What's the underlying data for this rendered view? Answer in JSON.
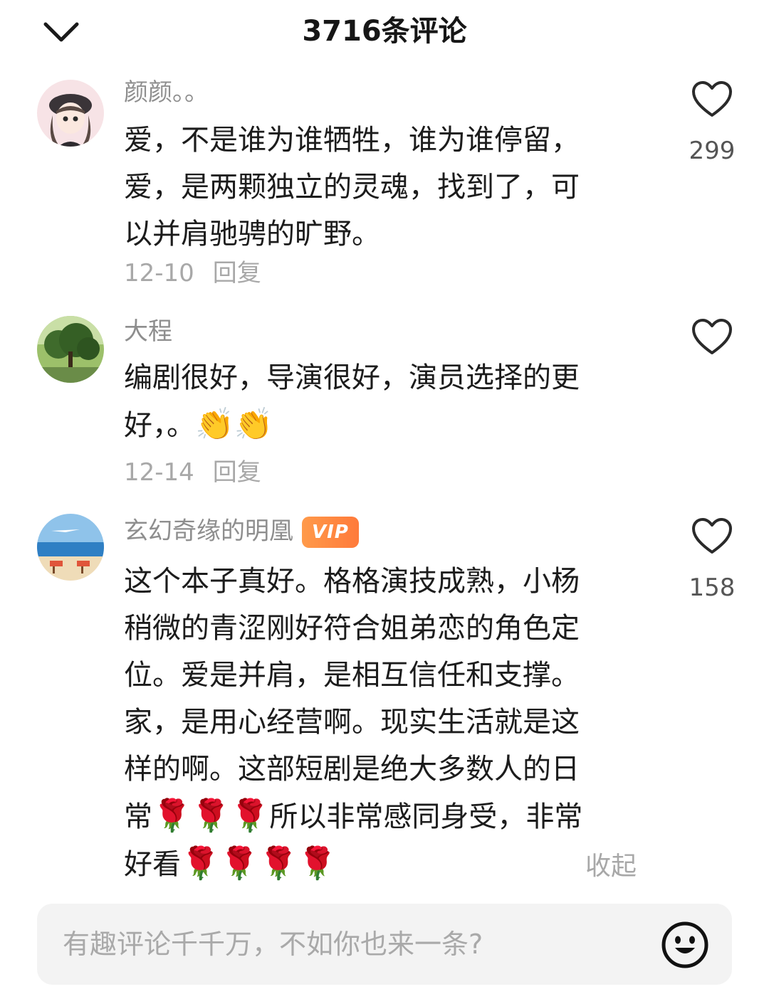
{
  "header": {
    "title": "3716条评论"
  },
  "comments": [
    {
      "username": "颜颜。。",
      "text": "爱，不是谁为谁牺牲，谁为谁停留，\n爱，是两颗独立的灵魂，找到了，可\n以并肩驰骋的旷野。",
      "date": "12-10",
      "reply_label": "回复",
      "likes": "299"
    },
    {
      "username": "大程",
      "text_main": "编剧很好，导演很好，演员选择的更\n好，。",
      "text_emoji": "👏👏",
      "date": "12-14",
      "reply_label": "回复",
      "likes": ""
    },
    {
      "username": "玄幻奇缘的明凰",
      "badge": "VIP",
      "text_part1": "这个本子真好。格格演技成熟，小杨\n稍微的青涩刚好符合姐弟恋的角色定\n位。爱是并肩，是相互信任和支撑。\n家，是用心经营啊。现实生活就是这\n样的啊。这部短剧是绝大多数人的日\n常",
      "emoji_a": "🌹🌹🌹",
      "text_part2": "所以非常感同身受，非常\n好看",
      "emoji_b": "🌹🌹🌹🌹",
      "likes": "158",
      "collapse_label": "收起"
    }
  ],
  "input": {
    "placeholder": "有趣评论千千万，不如你也来一条?"
  },
  "icons": {
    "back": "chevron-down-icon",
    "like": "heart-outline-icon",
    "emoji": "smiley-icon"
  },
  "colors": {
    "vip_badge": "#ff8a3d",
    "secondary_text": "#8e8e8e"
  }
}
